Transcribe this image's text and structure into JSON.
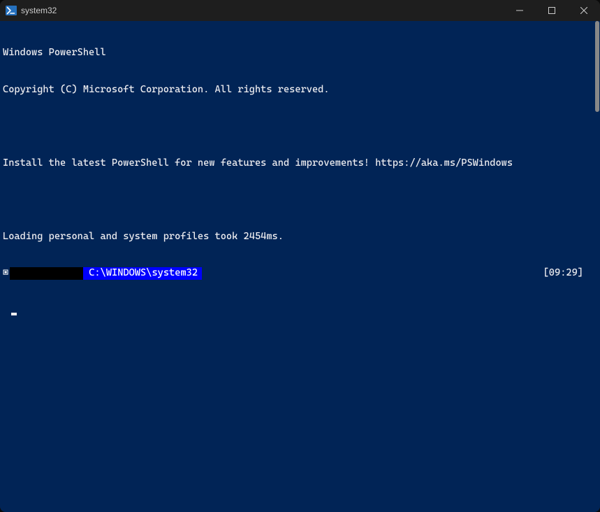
{
  "window": {
    "title": "system32"
  },
  "terminal": {
    "line1": "Windows PowerShell",
    "line2": "Copyright (C) Microsoft Corporation. All rights reserved.",
    "line3": "",
    "line4": "Install the latest PowerShell for new features and improvements! https://aka.ms/PSWindows",
    "line5": "",
    "line6": "Loading personal and system profiles took 2454ms.",
    "prompt": {
      "glyph": "▣",
      "path": "C:\\WINDOWS\\system32",
      "time": "[09:29]"
    }
  }
}
